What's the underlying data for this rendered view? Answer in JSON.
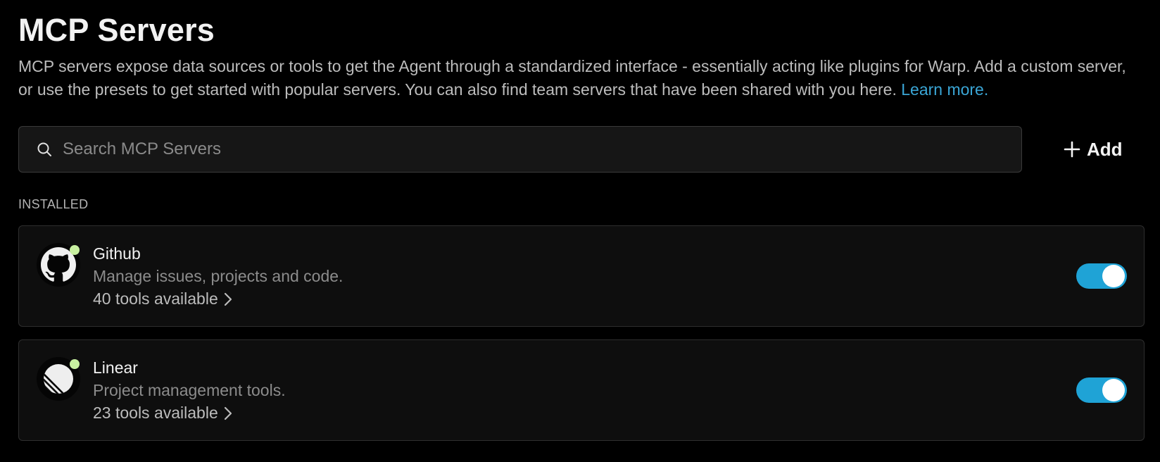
{
  "header": {
    "title": "MCP Servers",
    "description": "MCP servers expose data sources or tools to get the Agent through a standardized interface - essentially acting like plugins for Warp. Add a custom server, or use the presets to get started with popular servers. You can also find team servers that have been shared with you here.",
    "learn_more": "Learn more."
  },
  "search": {
    "placeholder": "Search MCP Servers",
    "value": "",
    "icon": "search-icon"
  },
  "add_button": {
    "label": "Add",
    "icon": "plus-icon"
  },
  "installed": {
    "section_label": "INSTALLED",
    "servers": [
      {
        "name": "Github",
        "description": "Manage issues, projects and code.",
        "tools": "40 tools available",
        "icon": "github-icon",
        "status": "online",
        "enabled": true
      },
      {
        "name": "Linear",
        "description": "Project management tools.",
        "tools": "23 tools available",
        "icon": "linear-icon",
        "status": "online",
        "enabled": true
      }
    ]
  },
  "colors": {
    "background": "#000000",
    "accent_link": "#3aa6d6",
    "toggle_on": "#1fa3d6",
    "status_online": "#c8f0a0",
    "card_background": "#0e0e0e",
    "card_border": "#2e2e2e"
  }
}
